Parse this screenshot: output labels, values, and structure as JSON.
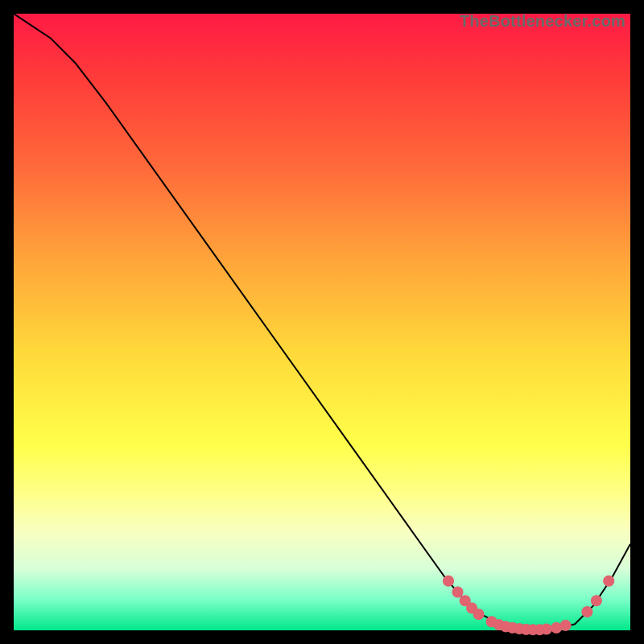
{
  "watermark": "TheBottlenecker.com",
  "colors": {
    "marker": "#e0636f",
    "curve": "#000000"
  },
  "chart_data": {
    "type": "line",
    "title": "",
    "xlabel": "",
    "ylabel": "",
    "xlim": [
      0,
      100
    ],
    "ylim": [
      0,
      100
    ],
    "series": [
      {
        "name": "bottleneck-curve",
        "x": [
          0,
          3,
          6,
          10,
          15,
          20,
          25,
          30,
          35,
          40,
          45,
          50,
          55,
          60,
          65,
          70,
          73,
          76,
          79,
          82,
          85,
          88,
          91,
          94,
          97,
          100
        ],
        "y": [
          100,
          98,
          96,
          92,
          85.5,
          78.5,
          71.5,
          64.5,
          57.5,
          50.5,
          43.5,
          36.5,
          29.5,
          22.5,
          15.5,
          8.5,
          5,
          2.5,
          1,
          0.3,
          0,
          0.3,
          1,
          4,
          8.5,
          14
        ]
      }
    ],
    "markers": {
      "name": "highlight-points",
      "points": [
        {
          "x": 70.5,
          "y": 8.0
        },
        {
          "x": 72.0,
          "y": 6.2
        },
        {
          "x": 73.2,
          "y": 4.8
        },
        {
          "x": 74.3,
          "y": 3.6
        },
        {
          "x": 75.4,
          "y": 2.6
        },
        {
          "x": 77.5,
          "y": 1.4
        },
        {
          "x": 78.7,
          "y": 0.9
        },
        {
          "x": 79.8,
          "y": 0.6
        },
        {
          "x": 80.9,
          "y": 0.4
        },
        {
          "x": 82.0,
          "y": 0.25
        },
        {
          "x": 83.1,
          "y": 0.15
        },
        {
          "x": 84.2,
          "y": 0.1
        },
        {
          "x": 85.3,
          "y": 0.1
        },
        {
          "x": 86.4,
          "y": 0.2
        },
        {
          "x": 88.0,
          "y": 0.4
        },
        {
          "x": 89.5,
          "y": 0.8
        },
        {
          "x": 93.0,
          "y": 3.0
        },
        {
          "x": 94.5,
          "y": 4.8
        },
        {
          "x": 96.5,
          "y": 8.0
        }
      ]
    }
  }
}
